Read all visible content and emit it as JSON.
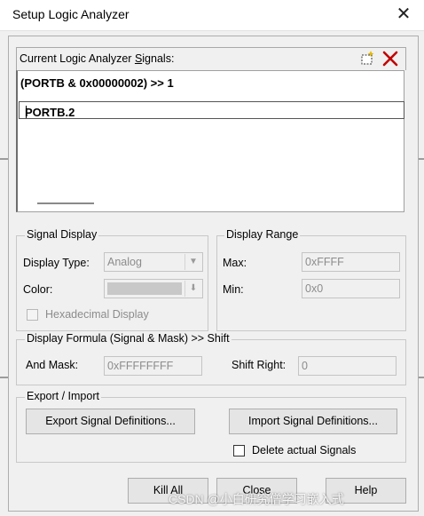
{
  "window": {
    "title": "Setup Logic Analyzer",
    "close_glyph": "✕"
  },
  "signals": {
    "header_prefix": "Current Logic Analyzer ",
    "header_underlined": "S",
    "header_suffix": "ignals:",
    "items": [
      "(PORTB & 0x00000002) >> 1"
    ],
    "editing_value": "PORTB.2",
    "new_icon": "new-signal-icon",
    "delete_icon": "delete-x-icon",
    "delete_color": "#c00000"
  },
  "signal_display": {
    "group_label": "Signal Display",
    "display_type_label": "Display Type:",
    "display_type_value": "Analog",
    "color_label": "Color:",
    "hex_label": "Hexadecimal Display",
    "hex_checked": false
  },
  "display_range": {
    "group_label": "Display Range",
    "max_label": "Max:",
    "max_value": "0xFFFF",
    "min_label": "Min:",
    "min_value": "0x0"
  },
  "formula": {
    "group_label": "Display Formula (Signal & Mask) >> Shift",
    "and_mask_label": "And Mask:",
    "and_mask_value": "0xFFFFFFFF",
    "shift_right_label": "Shift Right:",
    "shift_right_value": "0"
  },
  "export_import": {
    "group_label": "Export / Import",
    "export_button": "Export Signal Definitions...",
    "import_button": "Import Signal Definitions...",
    "delete_actual_label": "Delete actual Signals",
    "delete_actual_checked": false
  },
  "bottom_buttons": {
    "kill_all": "Kill All",
    "close": "Close",
    "help": "Help"
  },
  "watermark": "CSDN @小白研究僧学习嵌入式"
}
